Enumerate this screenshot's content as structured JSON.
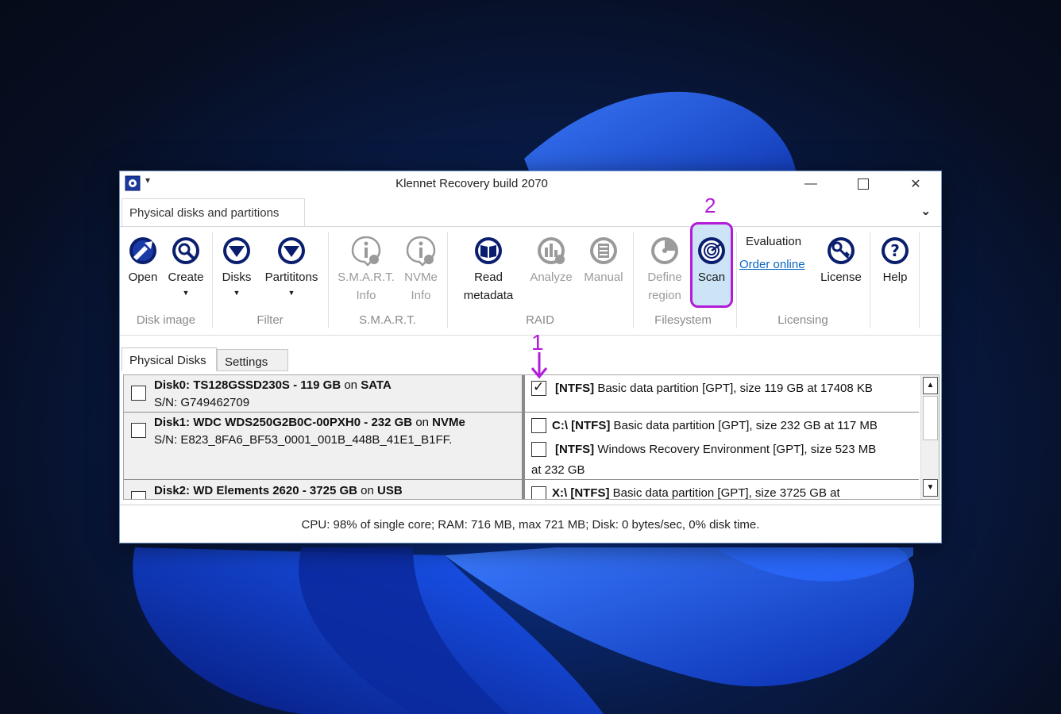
{
  "window": {
    "title": "Klennet Recovery build 2070",
    "minimize_glyph": "—",
    "close_glyph": "✕"
  },
  "ribbon": {
    "tab_label": "Physical disks and partitions",
    "collapse_glyph": "⌄",
    "groups": {
      "disk_image": "Disk image",
      "filter": "Filter",
      "smart": "S.M.A.R.T.",
      "raid": "RAID",
      "filesystem": "Filesystem",
      "licensing": "Licensing"
    },
    "buttons": {
      "open": "Open",
      "create": "Create",
      "disks": "Disks",
      "partitions": "Partititons",
      "smart_info_1": "S.M.A.R.T.",
      "smart_info_2": "Info",
      "nvme_info_1": "NVMe",
      "nvme_info_2": "Info",
      "read_metadata_1": "Read",
      "read_metadata_2": "metadata",
      "analyze": "Analyze",
      "manual": "Manual",
      "define_region_1": "Define",
      "define_region_2": "region",
      "scan": "Scan",
      "license": "License",
      "help": "Help"
    },
    "dropdown_glyph": "▼",
    "evaluation": "Evaluation",
    "order_online": "Order online"
  },
  "annotations": {
    "step1": "1",
    "step2": "2"
  },
  "tabs": {
    "physical_disks": "Physical Disks",
    "settings": "Settings"
  },
  "disks": [
    {
      "name": "Disk0:  TS128GSSD230S",
      "size": "119 GB",
      "on": "on",
      "bus": "SATA",
      "serial": "S/N: G749462709",
      "checked": false
    },
    {
      "name": "Disk1:  WDC WDS250G2B0C-00PXH0",
      "size": "232 GB",
      "on": "on",
      "bus": "NVMe",
      "serial": "S/N: E823_8FA6_BF53_0001_001B_448B_41E1_B1FF.",
      "checked": false
    },
    {
      "name": "Disk2: WD Elements 2620",
      "size": "3725 GB",
      "on": "on",
      "bus": "USB",
      "serial": "",
      "checked": false
    }
  ],
  "partitions": [
    {
      "drive": "",
      "fs": "[NTFS]",
      "desc": "Basic data partition [GPT], size 119 GB at 17408 KB",
      "checked": true
    },
    {
      "drive": "C:\\",
      "fs": "[NTFS]",
      "desc": "Basic data partition [GPT], size 232 GB at 117 MB",
      "checked": false
    },
    {
      "drive": "",
      "fs": "[NTFS]",
      "desc": "Windows Recovery Environment [GPT], size 523 MB",
      "desc2": "at 232 GB",
      "checked": false
    },
    {
      "drive": "X:\\",
      "fs": "[NTFS]",
      "desc": "Basic data partition [GPT], size 3725 GB at",
      "checked": false
    }
  ],
  "separator": "-",
  "scrollbar": {
    "up": "▲",
    "down": "▼"
  },
  "status": "CPU: 98% of single core; RAM: 716 MB, max 721 MB; Disk: 0 bytes/sec, 0% disk time.",
  "colors": {
    "accent": "#b21bd8",
    "icon_navy": "#0a1e6e",
    "link": "#0a66c2"
  }
}
